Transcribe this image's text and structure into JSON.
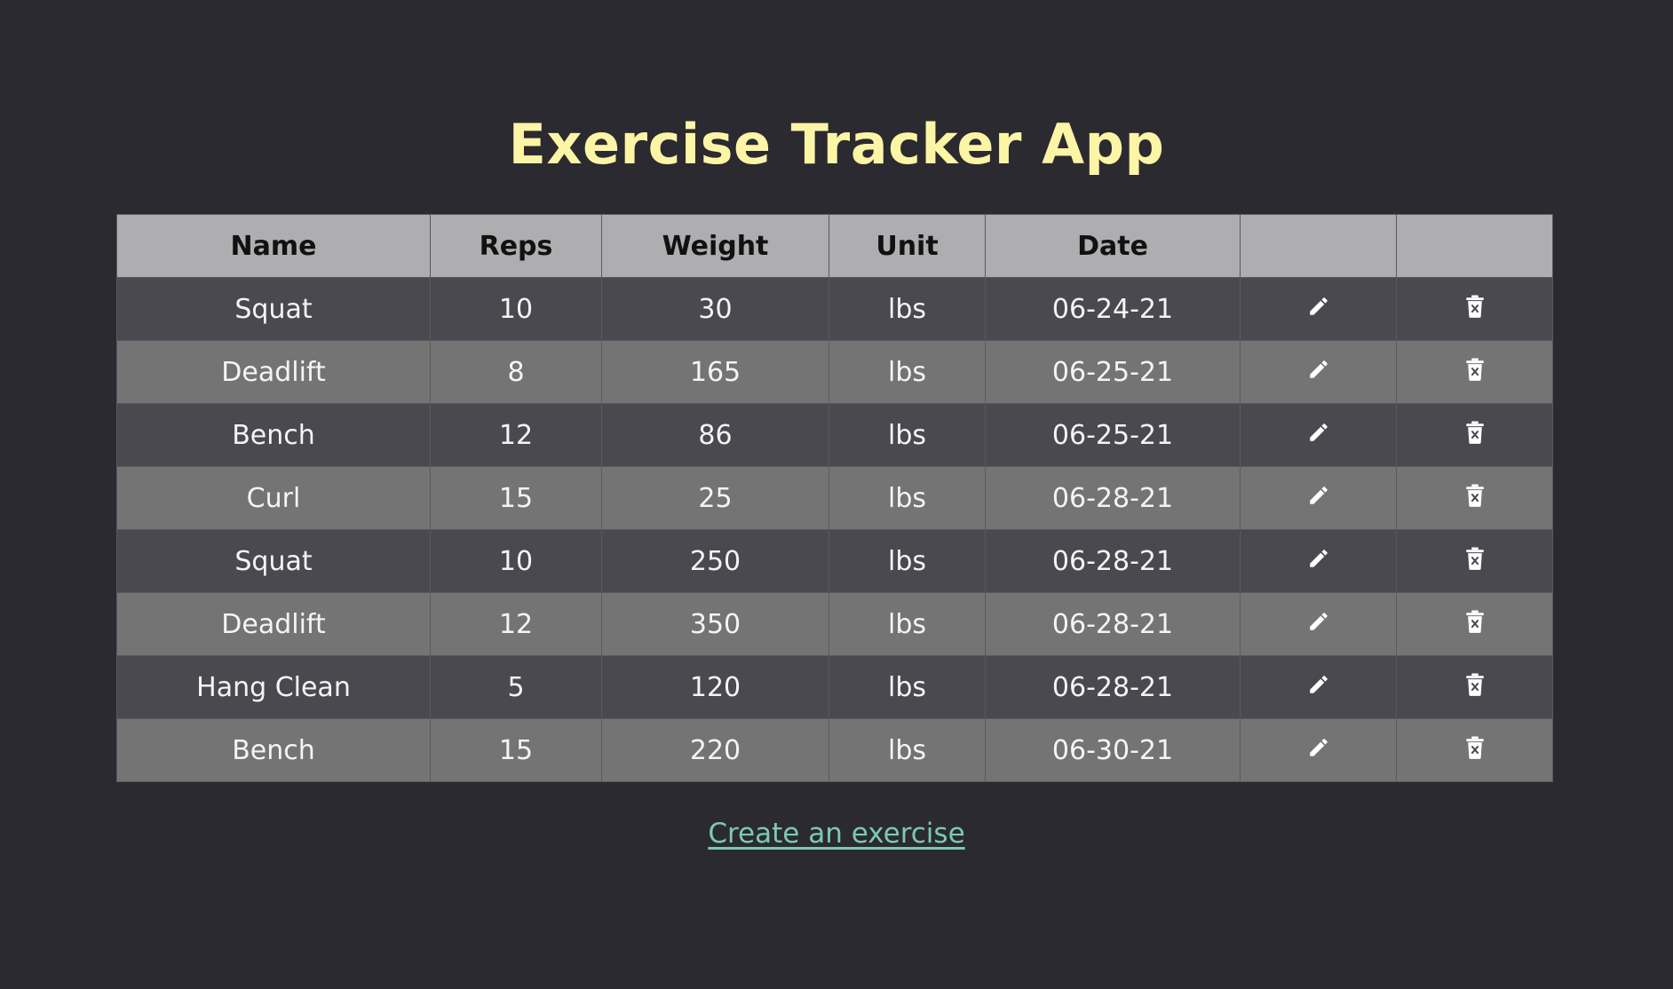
{
  "app": {
    "title": "Exercise Tracker App"
  },
  "table": {
    "headers": [
      "Name",
      "Reps",
      "Weight",
      "Unit",
      "Date",
      "",
      ""
    ],
    "rows": [
      {
        "name": "Squat",
        "reps": "10",
        "weight": "30",
        "unit": "lbs",
        "date": "06-24-21"
      },
      {
        "name": "Deadlift",
        "reps": "8",
        "weight": "165",
        "unit": "lbs",
        "date": "06-25-21"
      },
      {
        "name": "Bench",
        "reps": "12",
        "weight": "86",
        "unit": "lbs",
        "date": "06-25-21"
      },
      {
        "name": "Curl",
        "reps": "15",
        "weight": "25",
        "unit": "lbs",
        "date": "06-28-21"
      },
      {
        "name": "Squat",
        "reps": "10",
        "weight": "250",
        "unit": "lbs",
        "date": "06-28-21"
      },
      {
        "name": "Deadlift",
        "reps": "12",
        "weight": "350",
        "unit": "lbs",
        "date": "06-28-21"
      },
      {
        "name": "Hang Clean",
        "reps": "5",
        "weight": "120",
        "unit": "lbs",
        "date": "06-28-21"
      },
      {
        "name": "Bench",
        "reps": "15",
        "weight": "220",
        "unit": "lbs",
        "date": "06-30-21"
      }
    ],
    "row_actions": {
      "edit_icon": "pencil-icon",
      "delete_icon": "trash-icon"
    }
  },
  "footer": {
    "create_link_label": "Create an exercise"
  },
  "colors": {
    "background": "#2b2a30",
    "title": "#fdf5a6",
    "header_bg": "#aeadb0",
    "row_dark": "#4a494f",
    "row_light": "#747474",
    "link": "#7ccaae"
  }
}
